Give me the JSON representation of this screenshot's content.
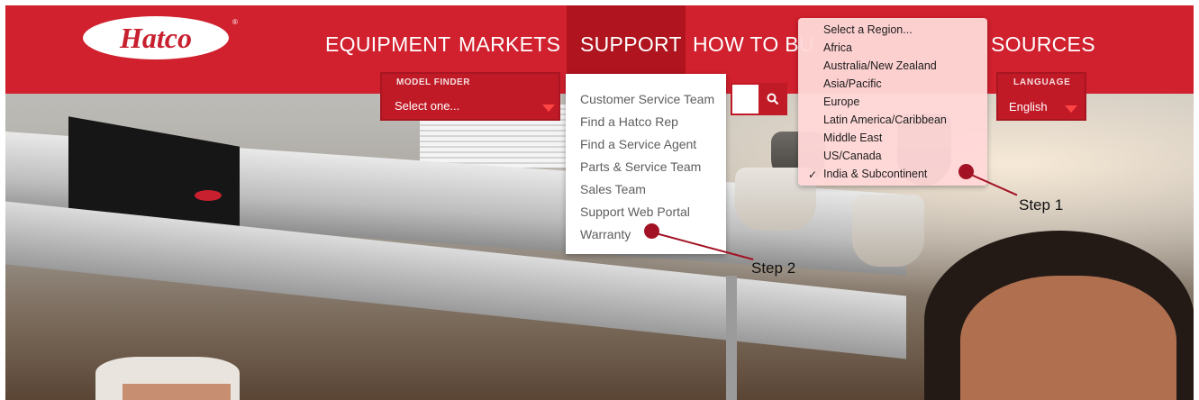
{
  "brand": {
    "logo_text": "Hatco",
    "registered": "®"
  },
  "nav": {
    "items": [
      {
        "label": "EQUIPMENT"
      },
      {
        "label": "MARKETS"
      },
      {
        "label": "SUPPORT"
      },
      {
        "label": "HOW TO BU"
      },
      {
        "label": "SOURCES"
      }
    ]
  },
  "model_finder": {
    "label": "MODEL FINDER",
    "value": "Select one..."
  },
  "search": {
    "icon": "search-icon"
  },
  "language": {
    "label": "LANGUAGE",
    "value": "English"
  },
  "support_menu": {
    "items": [
      "Customer Service Team",
      "Find a Hatco Rep",
      "Find a Service Agent",
      "Parts & Service Team",
      "Sales Team",
      "Support Web Portal",
      "Warranty"
    ]
  },
  "region_menu": {
    "items": [
      "Select a Region...",
      "Africa",
      "Australia/New Zealand",
      "Asia/Pacific",
      "Europe",
      "Latin America/Caribbean",
      "Middle East",
      "US/Canada",
      "India & Subcontinent"
    ],
    "selected": "India & Subcontinent",
    "check_mark": "✓"
  },
  "annotations": {
    "step1": "Step 1",
    "step2": "Step 2"
  },
  "colors": {
    "brand_red": "#d1202e",
    "support_active": "#b0141f",
    "annotation": "#a31224"
  }
}
